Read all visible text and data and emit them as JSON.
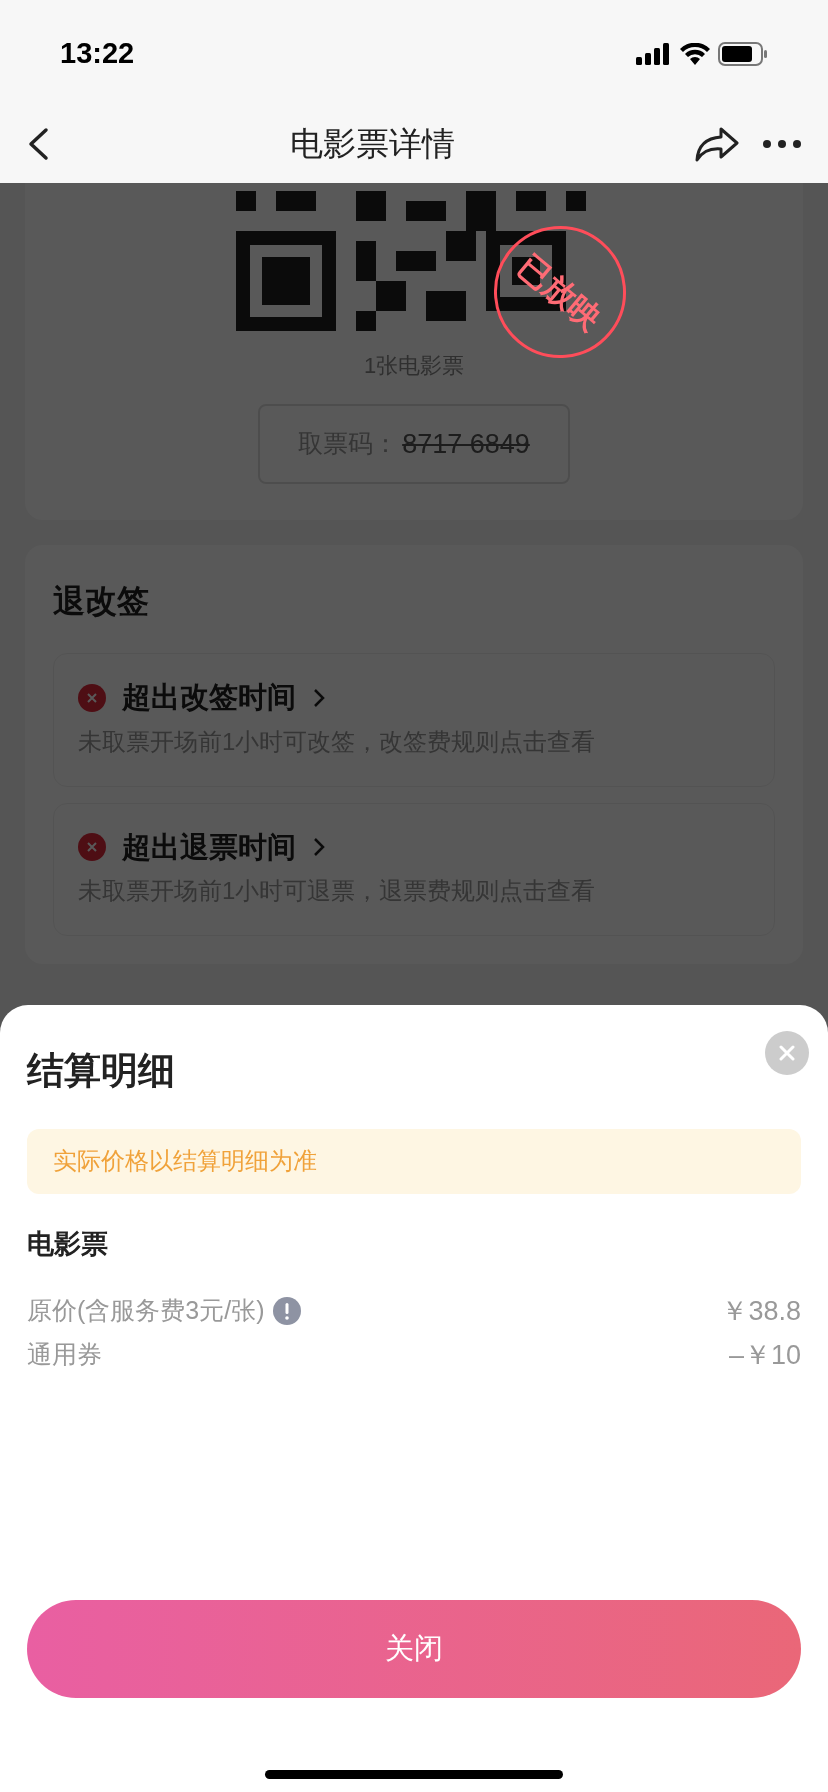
{
  "status_bar": {
    "time": "13:22"
  },
  "nav": {
    "title": "电影票详情"
  },
  "ticket": {
    "stamp": "已放映",
    "count": "1张电影票",
    "code_label": "取票码：",
    "code": "8717 6849",
    "code_struck": true
  },
  "policy": {
    "title": "退改签",
    "items": [
      {
        "title": "超出改签时间",
        "note": "未取票开场前1小时可改签，改签费规则点击查看"
      },
      {
        "title": "超出退票时间",
        "note": "未取票开场前1小时可退票，退票费规则点击查看"
      }
    ]
  },
  "sheet": {
    "title": "结算明细",
    "notice": "实际价格以结算明细为准",
    "section": "电影票",
    "rows": [
      {
        "label": "原价(含服务费3元/张)",
        "info": true,
        "amount": "￥38.8"
      },
      {
        "label": "通用券",
        "info": false,
        "amount": "–￥10"
      }
    ],
    "button": "关闭"
  }
}
